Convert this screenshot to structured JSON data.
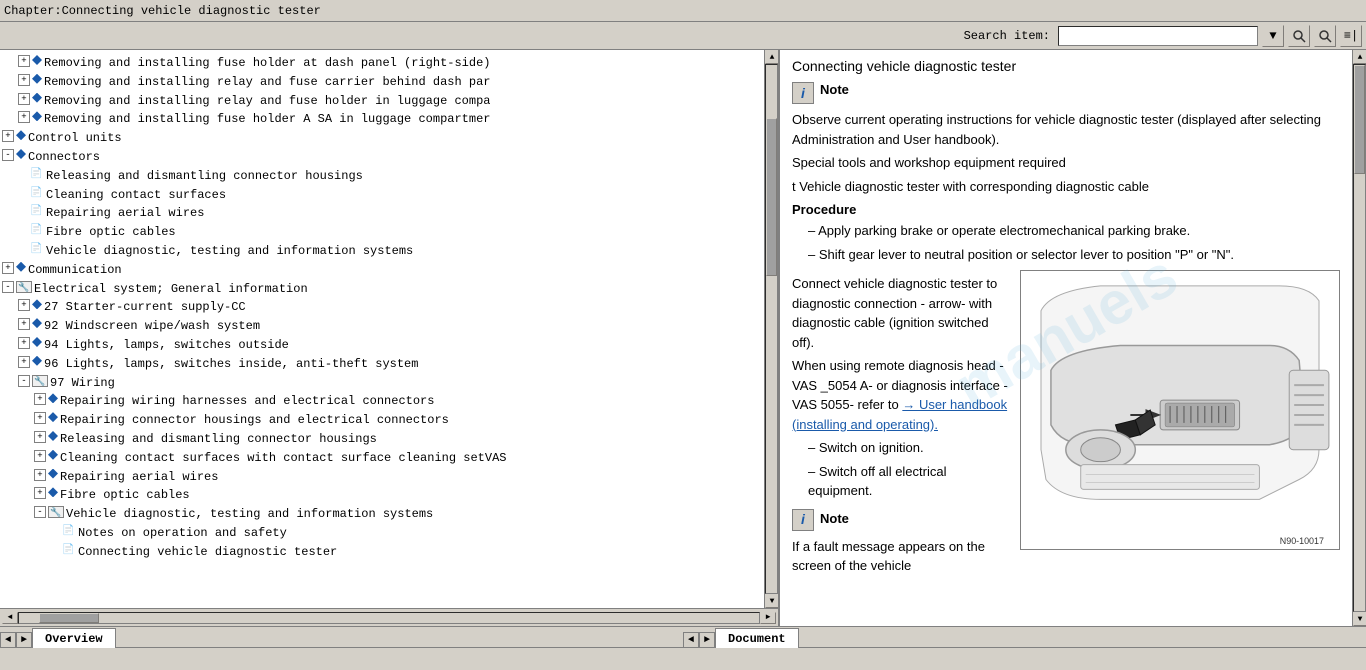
{
  "titleBar": {
    "text": "Chapter:Connecting vehicle diagnostic tester"
  },
  "toolbar": {
    "searchLabel": "Search item:",
    "searchPlaceholder": "",
    "dropdownArrow": "▼",
    "btn1": "🔍",
    "btn2": "🔍",
    "btn3": "≡"
  },
  "tree": {
    "items": [
      {
        "level": 1,
        "type": "expand",
        "icon": "diamond",
        "text": "Removing and installing fuse holder at dash panel (right-side)",
        "expand": "+"
      },
      {
        "level": 1,
        "type": "expand",
        "icon": "diamond",
        "text": "Removing and installing relay and fuse carrier behind dash pa",
        "expand": "+"
      },
      {
        "level": 1,
        "type": "expand",
        "icon": "diamond",
        "text": "Removing and installing relay and fuse holder in luggage comp",
        "expand": "+"
      },
      {
        "level": 1,
        "type": "expand",
        "icon": "diamond",
        "text": "Removing and installing fuse holder A SA in luggage compartme",
        "expand": "+"
      },
      {
        "level": 0,
        "type": "expand",
        "icon": "diamond",
        "text": "Control units",
        "expand": "+"
      },
      {
        "level": 0,
        "type": "collapse",
        "icon": "diamond",
        "text": "Connectors",
        "expand": "-"
      },
      {
        "level": 1,
        "type": "doc",
        "icon": "doc",
        "text": "Releasing and dismantling connector housings"
      },
      {
        "level": 1,
        "type": "doc",
        "icon": "doc",
        "text": "Cleaning contact surfaces"
      },
      {
        "level": 1,
        "type": "doc",
        "icon": "doc",
        "text": "Repairing aerial wires"
      },
      {
        "level": 1,
        "type": "doc",
        "icon": "doc",
        "text": "Fibre optic cables"
      },
      {
        "level": 1,
        "type": "doc",
        "icon": "doc",
        "text": "Vehicle diagnostic, testing and information systems"
      },
      {
        "level": 0,
        "type": "expand",
        "icon": "diamond",
        "text": "Communication",
        "expand": "+"
      },
      {
        "level": 0,
        "type": "collapse",
        "icon": "book",
        "text": "Electrical system; General information",
        "expand": "-"
      },
      {
        "level": 1,
        "type": "expand",
        "icon": "diamond",
        "text": "27 Starter-current supply-CC",
        "expand": "+"
      },
      {
        "level": 1,
        "type": "expand",
        "icon": "diamond",
        "text": "92 Windscreen wipe/wash system",
        "expand": "+"
      },
      {
        "level": 1,
        "type": "expand",
        "icon": "diamond",
        "text": "94 Lights, lamps, switches outside",
        "expand": "+"
      },
      {
        "level": 1,
        "type": "expand",
        "icon": "diamond",
        "text": "96 Lights, lamps, switches inside, anti-theft system",
        "expand": "+"
      },
      {
        "level": 1,
        "type": "collapse",
        "icon": "book",
        "text": "97 Wiring",
        "expand": "-"
      },
      {
        "level": 2,
        "type": "expand",
        "icon": "diamond",
        "text": "Repairing wiring harnesses and electrical connectors",
        "expand": "+"
      },
      {
        "level": 2,
        "type": "expand",
        "icon": "diamond",
        "text": "Repairing connector housings and electrical connectors",
        "expand": "+"
      },
      {
        "level": 2,
        "type": "expand",
        "icon": "diamond",
        "text": "Releasing and dismantling connector housings",
        "expand": "+"
      },
      {
        "level": 2,
        "type": "expand",
        "icon": "diamond",
        "text": "Cleaning contact surfaces with contact surface cleaning setVAS",
        "expand": "+"
      },
      {
        "level": 2,
        "type": "expand",
        "icon": "diamond",
        "text": "Repairing aerial wires",
        "expand": "+"
      },
      {
        "level": 2,
        "type": "expand",
        "icon": "diamond",
        "text": "Fibre optic cables",
        "expand": "+"
      },
      {
        "level": 2,
        "type": "collapse",
        "icon": "book",
        "text": "Vehicle diagnostic, testing and information systems",
        "expand": "-"
      },
      {
        "level": 3,
        "type": "doc",
        "icon": "doc",
        "text": "Notes on operation and safety"
      },
      {
        "level": 3,
        "type": "doc",
        "icon": "doc",
        "text": "Connecting vehicle diagnostic tester"
      }
    ]
  },
  "rightPanel": {
    "title": "Connecting vehicle diagnostic tester",
    "noteLabel": "Note",
    "noteIcon": "i",
    "noteText1": "Observe current operating instructions for vehicle diagnostic tester (displayed after selecting Administration and User handbook).",
    "specialTools": "Special tools and workshop equipment required",
    "toolItem": "t  Vehicle diagnostic tester with corresponding diagnostic cable",
    "procedure": "Procedure",
    "steps": [
      "Apply parking brake or operate electromechanical parking brake.",
      "Shift gear lever to neutral position or selector lever to position \"P\" or \"N\"."
    ],
    "connectText": "Connect vehicle diagnostic tester to diagnostic connection - arrow- with diagnostic cable (ignition switched off).",
    "remoteText": "When using remote diagnosis head -VAS _5054 A- or diagnosis interface -VAS 5055- refer to",
    "linkText": "→ User handbook (installing and operating).",
    "switchOn": "Switch on ignition.",
    "switchOff": "Switch off all electrical equipment.",
    "note2Label": "Note",
    "note2Text": "If a fault message appears on the screen of the vehicle",
    "diagramLabel": "N90-10017",
    "arrowText": "arrow - With diagnostic"
  },
  "bottomTabs": {
    "left": {
      "navPrev": "◄",
      "navNext": "►",
      "tab1": "Overview"
    },
    "right": {
      "navPrev": "◄",
      "navNext": "►",
      "tab1": "Document"
    }
  }
}
